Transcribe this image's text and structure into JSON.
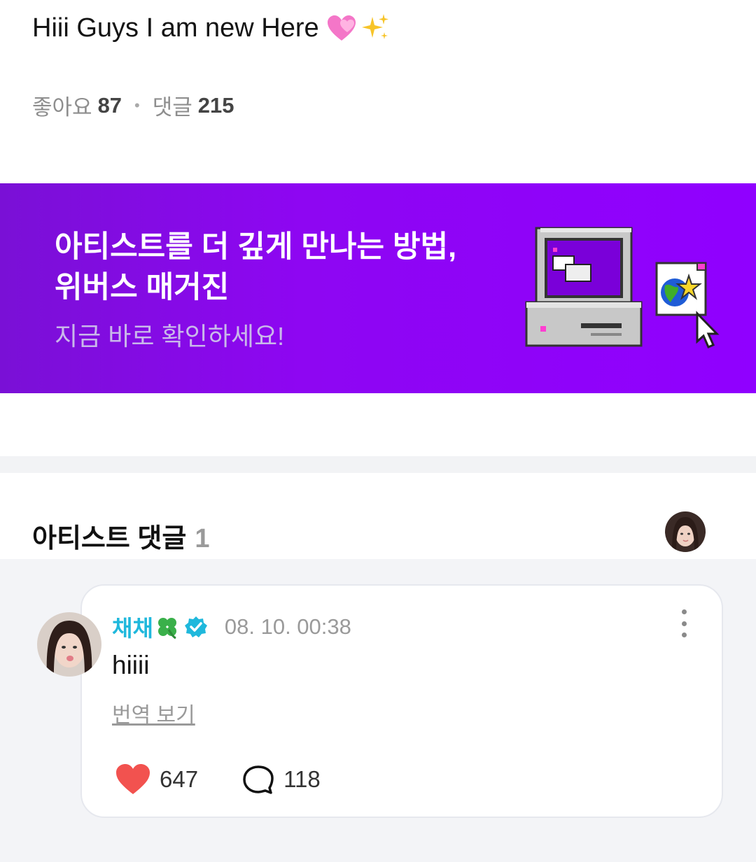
{
  "post": {
    "title": "Hiii Guys I am new Here",
    "title_emojis": [
      "heart-icon",
      "sparkles-icon"
    ],
    "like_label": "좋아요",
    "like_count": "87",
    "comment_label": "댓글",
    "comment_count": "215"
  },
  "banner": {
    "line1": "아티스트를 더 깊게 만나는 방법,",
    "line2": "위버스 매거진",
    "subtitle": "지금 바로 확인하세요!",
    "background_color": "#8e06f2",
    "art_icon": "retro-computer-icon"
  },
  "artist_comments": {
    "title": "아티스트 댓글",
    "count": "1",
    "comment": {
      "author": "채채",
      "author_color": "#1fb8dc",
      "timestamp": "08. 10. 00:38",
      "text": "hiiii",
      "translate_label": "번역 보기",
      "likes": "647",
      "replies": "118",
      "like_color": "#f2524f"
    }
  }
}
